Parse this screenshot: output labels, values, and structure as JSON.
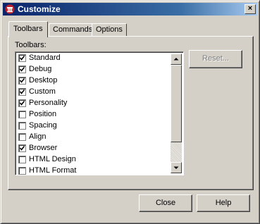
{
  "window": {
    "title": "Customize",
    "close_glyph": "×"
  },
  "tabs": [
    {
      "label": "Toolbars",
      "active": true
    },
    {
      "label": "Commands",
      "active": false
    },
    {
      "label": "Options",
      "active": false
    }
  ],
  "toolbars_panel": {
    "list_label": "Toolbars:",
    "items": [
      {
        "label": "Standard",
        "checked": true
      },
      {
        "label": "Debug",
        "checked": true
      },
      {
        "label": "Desktop",
        "checked": true
      },
      {
        "label": "Custom",
        "checked": true
      },
      {
        "label": "Personality",
        "checked": true
      },
      {
        "label": "Position",
        "checked": false
      },
      {
        "label": "Spacing",
        "checked": false
      },
      {
        "label": "Align",
        "checked": false
      },
      {
        "label": "Browser",
        "checked": true
      },
      {
        "label": "HTML Design",
        "checked": false
      },
      {
        "label": "HTML Format",
        "checked": false
      }
    ],
    "reset_label": "Reset..."
  },
  "footer": {
    "close_label": "Close",
    "help_label": "Help"
  },
  "icons": {
    "app": "app-icon",
    "close": "close-icon",
    "check": "checkmark-icon",
    "scroll_up": "arrow-up-icon",
    "scroll_down": "arrow-down-icon"
  },
  "colors": {
    "face": "#d4d0c8",
    "title_start": "#0a246a",
    "title_end": "#a6caf0",
    "icon_red": "#c0202a"
  }
}
